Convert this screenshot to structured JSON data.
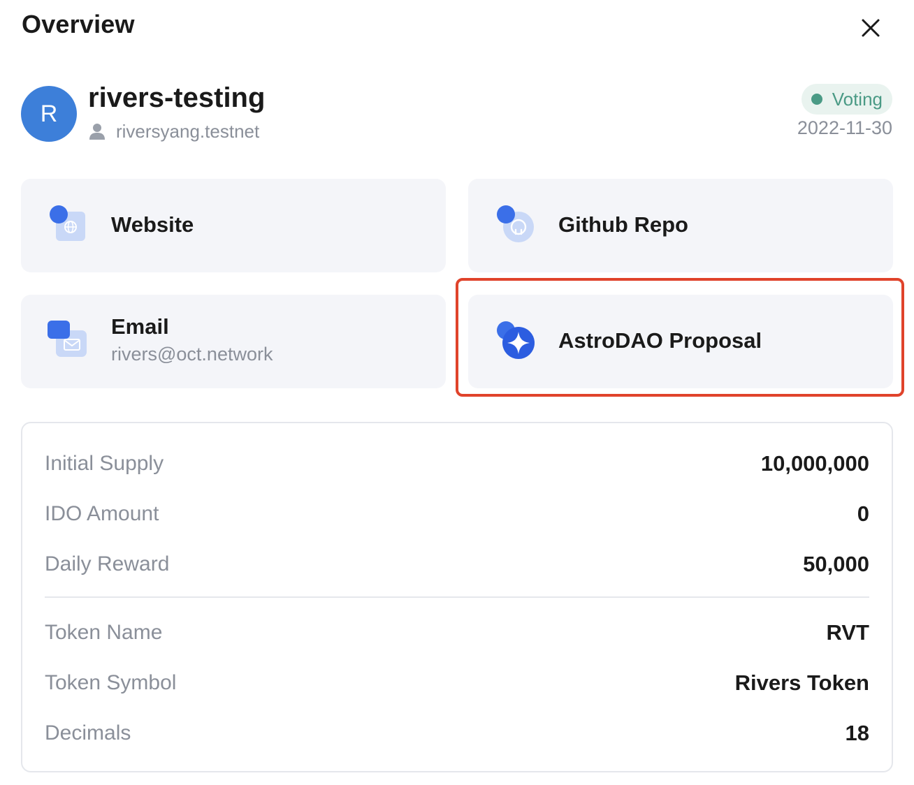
{
  "header": {
    "title": "Overview",
    "close_icon": "close-icon"
  },
  "project": {
    "avatar_letter": "R",
    "name": "rivers-testing",
    "account_icon": "user-icon",
    "account": "riversyang.testnet",
    "status": "Voting",
    "date": "2022-11-30"
  },
  "links": {
    "website": {
      "label": "Website",
      "icon": "globe-icon"
    },
    "github": {
      "label": "Github Repo",
      "icon": "github-icon"
    },
    "email": {
      "label": "Email",
      "value": "rivers@oct.network",
      "icon": "mail-icon"
    },
    "astrodao": {
      "label": "AstroDAO Proposal",
      "icon": "astrodao-icon",
      "highlighted": true
    }
  },
  "token_info": {
    "supply_rows": [
      {
        "label": "Initial Supply",
        "value": "10,000,000"
      },
      {
        "label": "IDO Amount",
        "value": "0"
      },
      {
        "label": "Daily Reward",
        "value": "50,000"
      }
    ],
    "token_rows": [
      {
        "label": "Token Name",
        "value": "RVT"
      },
      {
        "label": "Token Symbol",
        "value": "Rivers Token"
      },
      {
        "label": "Decimals",
        "value": "18"
      }
    ]
  },
  "colors": {
    "accent_blue": "#3d7fd9",
    "status_green": "#4a9a85",
    "highlight_red": "#e0432b",
    "card_bg": "#f4f5f9"
  }
}
